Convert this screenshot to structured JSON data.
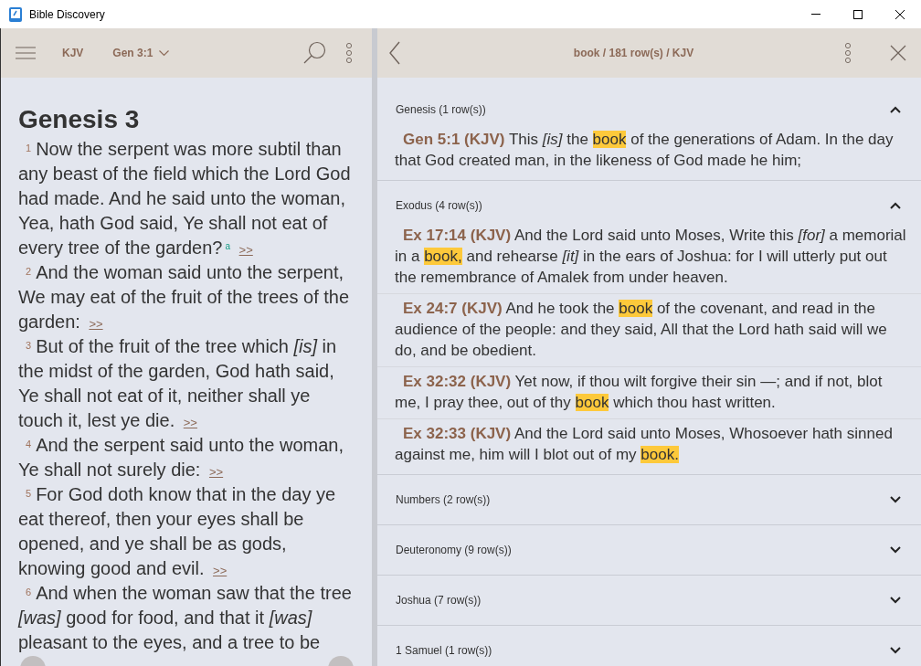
{
  "window": {
    "title": "Bible Discovery"
  },
  "reader": {
    "version": "KJV",
    "reference": "Gen 3:1",
    "heading": "Genesis 3",
    "verses": [
      {
        "number": "1",
        "text": "Now the serpent was more subtil than any beast of the field which the Lord God had made. And he said unto the woman, Yea, hath God said, Ye shall not eat of every tree of the garden?",
        "footnote": "a",
        "link": ">>"
      },
      {
        "number": "2",
        "text": "And the woman said unto the serpent, We may eat of the fruit of the trees of the garden:",
        "link": ">>"
      },
      {
        "number": "3",
        "text": "But of the fruit of the tree which *[is]* in the midst of the garden, God hath said, Ye shall not eat of it, neither shall ye touch it, lest ye die.",
        "link": ">>"
      },
      {
        "number": "4",
        "text": "And the serpent said unto the woman, Ye shall not surely die:",
        "link": ">>"
      },
      {
        "number": "5",
        "text": "For God doth know that in the day ye eat thereof, then your eyes shall be opened, and ye shall be as gods, knowing good and evil.",
        "link": ">>"
      },
      {
        "number": "6",
        "text": "And when the woman saw that the tree *[was]* good for food, and that it *[was]* pleasant to the eyes, and a tree to be"
      }
    ]
  },
  "search": {
    "title": "book / 181 row(s) / KJV",
    "groups": [
      {
        "label": "Genesis (1 row(s))",
        "expanded": true,
        "results": [
          {
            "reference": "Gen 5:1 (KJV)",
            "before": "This *[is]* the",
            "match": "book",
            "after": "of the generations of Adam. In the day that God created man, in the likeness of God made he him;"
          }
        ]
      },
      {
        "label": "Exodus (4 row(s))",
        "expanded": true,
        "results": [
          {
            "reference": "Ex 17:14 (KJV)",
            "before": "And the Lord said unto Moses, Write this *[for]* a memorial in a",
            "match": "book,",
            "after": "and rehearse *[it]* in the ears of Joshua: for I will utterly put out the remembrance of Amalek from under heaven."
          },
          {
            "reference": "Ex 24:7 (KJV)",
            "before": "And he took the",
            "match": "book",
            "after": "of the covenant, and read in the audience of the people: and they said, All that the Lord hath said will we do, and be obedient."
          },
          {
            "reference": "Ex 32:32 (KJV)",
            "before": "Yet now, if thou wilt forgive their sin —; and if not, blot me, I pray thee, out of thy",
            "match": "book",
            "after": "which thou hast written."
          },
          {
            "reference": "Ex 32:33 (KJV)",
            "before": "And the Lord said unto Moses, Whosoever hath sinned against me, him will I blot out of my",
            "match": "book."
          }
        ]
      },
      {
        "label": "Numbers (2 row(s))",
        "expanded": false
      },
      {
        "label": "Deuteronomy (9 row(s))",
        "expanded": false
      },
      {
        "label": "Joshua (7 row(s))",
        "expanded": false
      },
      {
        "label": "1 Samuel (1 row(s))",
        "expanded": false
      }
    ]
  }
}
